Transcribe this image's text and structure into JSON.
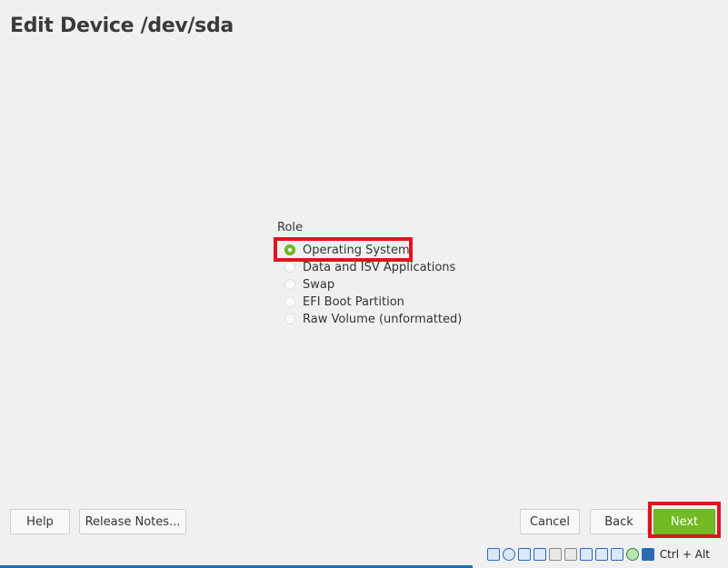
{
  "page": {
    "title": "Edit Device /dev/sda"
  },
  "role": {
    "label": "Role",
    "selected": "Operating System",
    "options": [
      {
        "label": "Operating System",
        "checked": true
      },
      {
        "label": "Data and ISV Applications",
        "checked": false
      },
      {
        "label": "Swap",
        "checked": false
      },
      {
        "label": "EFI Boot Partition",
        "checked": false
      },
      {
        "label": "Raw Volume (unformatted)",
        "checked": false
      }
    ]
  },
  "buttons": {
    "help": "Help",
    "release_notes": "Release Notes...",
    "cancel": "Cancel",
    "back": "Back",
    "next": "Next"
  },
  "colors": {
    "accent": "#73ba25",
    "highlight": "#e3131c",
    "background": "#f0f0f0"
  },
  "statusbar": {
    "host_key": "Ctrl + Alt",
    "icons": [
      "hard-disk-icon",
      "optical-disk-icon",
      "audio-icon",
      "network-icon",
      "usb-icon",
      "shared-folder-icon",
      "display-icon",
      "video-capture-icon",
      "virtualization-icon",
      "mouse-integration-icon",
      "download-icon"
    ]
  }
}
